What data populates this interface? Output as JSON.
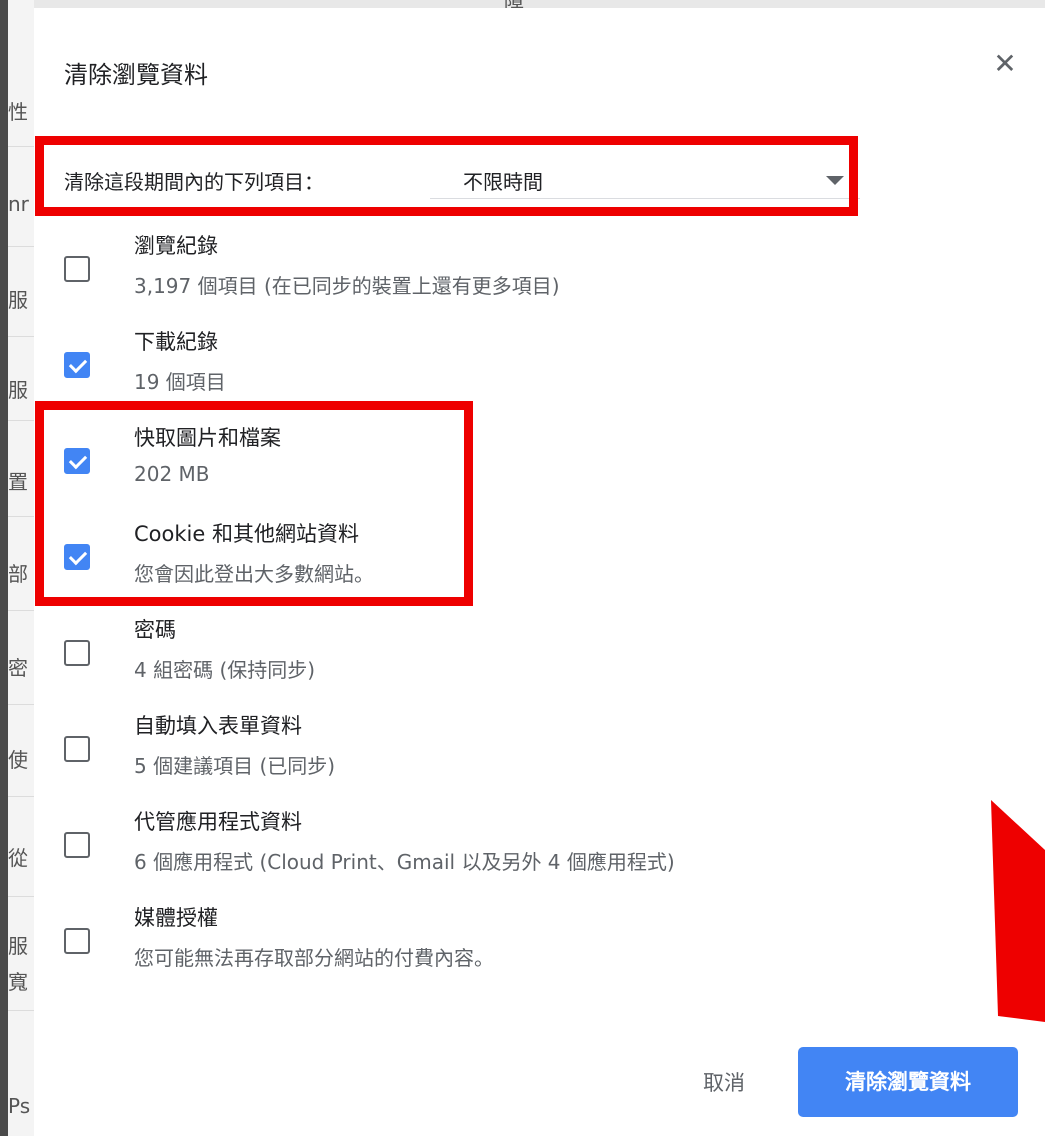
{
  "dialog": {
    "title": "清除瀏覽資料",
    "close_icon": "close-icon"
  },
  "time_range": {
    "label": "清除這段期間內的下列項目：",
    "selected": "不限時間"
  },
  "items": [
    {
      "label": "瀏覽紀錄",
      "description": "3,197 個項目 (在已同步的裝置上還有更多項目)",
      "checked": false
    },
    {
      "label": "下載紀錄",
      "description": "19 個項目",
      "checked": true
    },
    {
      "label": "快取圖片和檔案",
      "description": "202 MB",
      "checked": true
    },
    {
      "label": "Cookie 和其他網站資料",
      "description": "您會因此登出大多數網站。",
      "checked": true
    },
    {
      "label": "密碼",
      "description": "4 組密碼 (保持同步)",
      "checked": false
    },
    {
      "label": "自動填入表單資料",
      "description": "5 個建議項目 (已同步)",
      "checked": false
    },
    {
      "label": "代管應用程式資料",
      "description": "6 個應用程式 (Cloud Print、Gmail 以及另外 4 個應用程式)",
      "checked": false
    },
    {
      "label": "媒體授權",
      "description": "您可能無法再存取部分網站的付費內容。",
      "checked": false
    }
  ],
  "buttons": {
    "cancel": "取消",
    "confirm": "清除瀏覽資料"
  },
  "background_fragments": {
    "top": "障",
    "left": [
      "性",
      "nr",
      "服",
      "服",
      "置",
      "部",
      "密",
      "使",
      "從",
      "服",
      "寬",
      "Ps"
    ]
  },
  "colors": {
    "accent": "#4285f4",
    "highlight": "#ee0000"
  }
}
